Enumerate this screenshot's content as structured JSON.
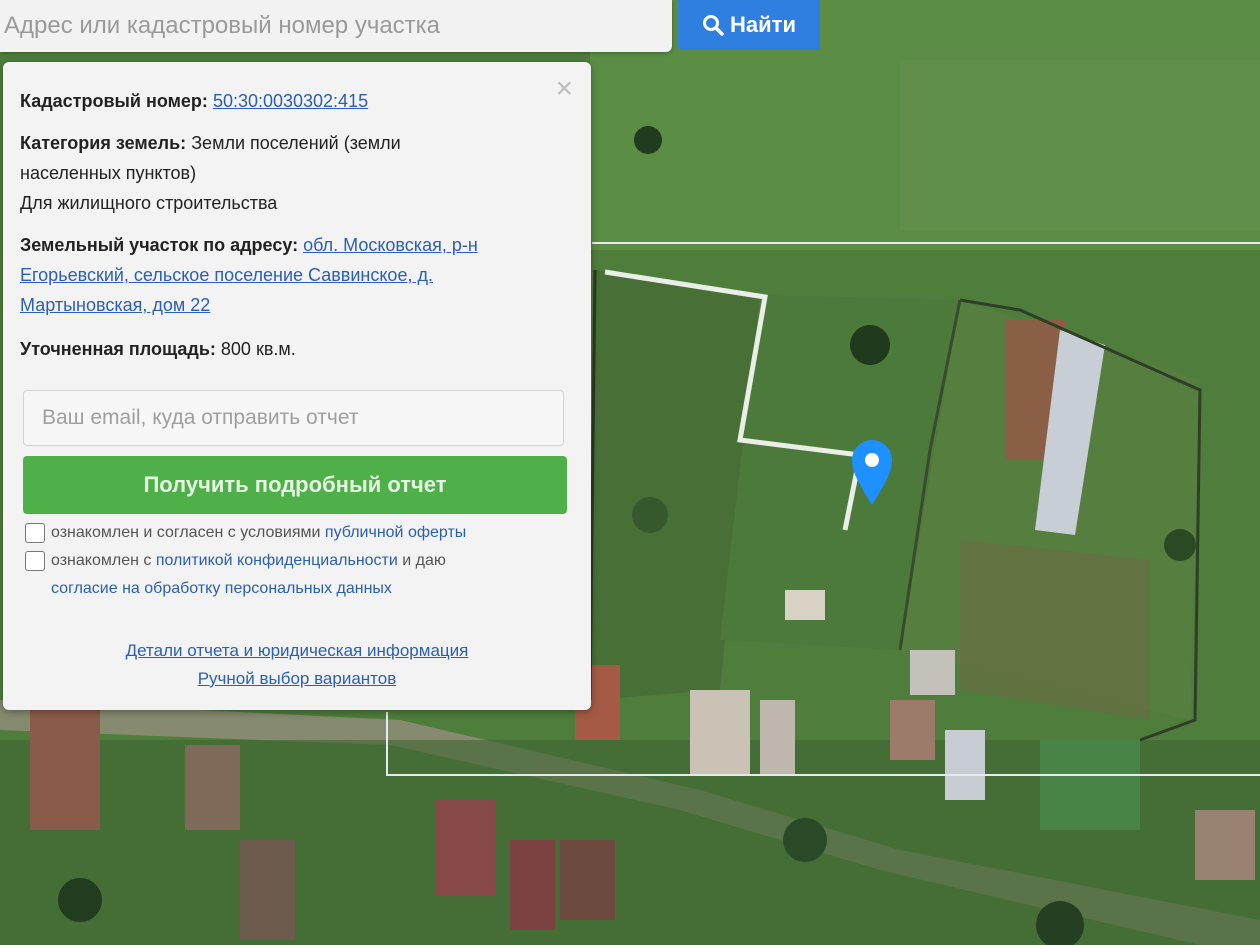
{
  "search": {
    "placeholder": "Адрес или кадастровый номер участка",
    "button_label": "Найти"
  },
  "panel": {
    "cadastral_label": "Кадастровый номер:",
    "cadastral_value": "50:30:0030302:415",
    "category_label": "Категория земель:",
    "category_value_line1": "Земли поселений (земли",
    "category_value_line2": "населенных пунктов)",
    "purpose": "Для жилищного строительства",
    "address_label": "Земельный участок по адресу:",
    "address_line1": "обл. Московская, р-н",
    "address_line2": "Егорьевский, сельское поселение Саввинское, д.",
    "address_line3": "Мартыновская, дом 22",
    "area_label": "Уточненная площадь:",
    "area_value": "800 кв.м.",
    "email_placeholder": "Ваш email, куда отправить отчет",
    "report_button": "Получить подробный отчет",
    "consent1_text": "ознакомлен и согласен с условиями",
    "consent1_link": "публичной оферты",
    "consent2_text": "ознакомлен с",
    "consent2_link": "политикой конфиденциальности",
    "consent2_text2": "и даю",
    "consent2_link2": "согласие на обработку персональных данных",
    "details_link": "Детали отчета и юридическая информация",
    "manual_link": "Ручной выбор вариантов",
    "close_symbol": "×"
  },
  "icons": {
    "search": "search-icon",
    "marker": "location-pin-icon",
    "close": "close-icon"
  },
  "colors": {
    "accent_blue": "#2f7fe0",
    "report_green": "#4fb04a",
    "link_blue": "#2a5fb3",
    "marker": "#1e90ff"
  }
}
